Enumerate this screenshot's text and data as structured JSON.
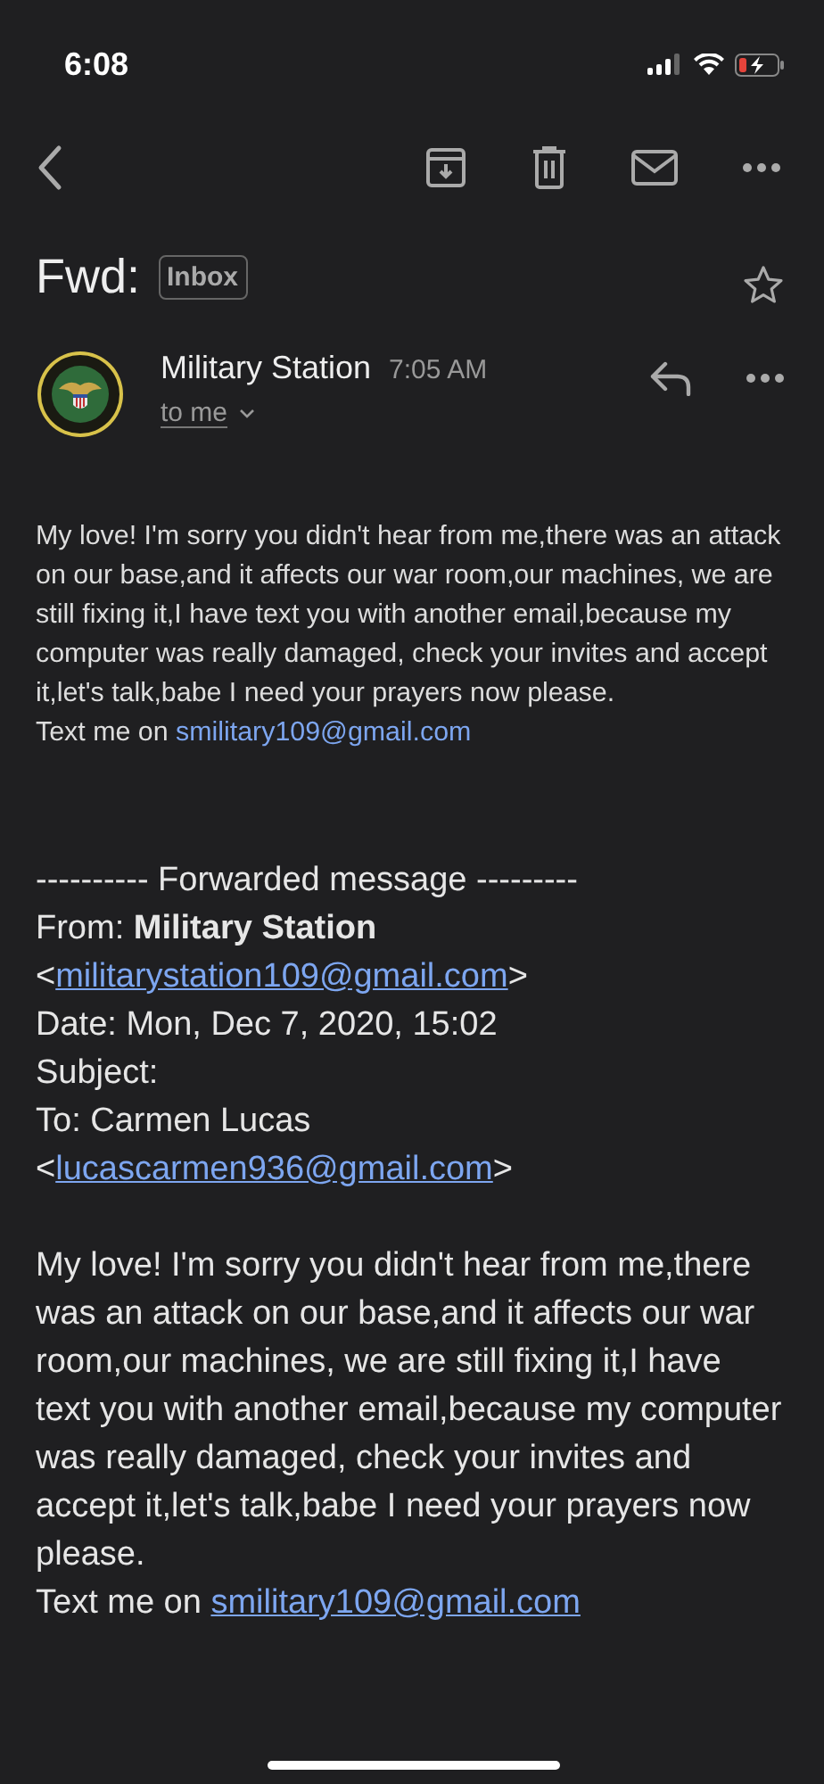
{
  "status_bar": {
    "time": "6:08",
    "battery_low": true
  },
  "subject": {
    "title": "Fwd:",
    "label": "Inbox",
    "starred": false
  },
  "sender": {
    "name": "Military Station",
    "time": "7:05 AM",
    "recipient": "to me"
  },
  "body": {
    "paragraph": "My love! I'm sorry you didn't hear from me,there was an attack on our base,and it affects our war room,our machines, we are still fixing it,I have text you with another email,because my computer was really damaged, check your invites and accept it,let's talk,babe I need your prayers now please.",
    "contact_prefix": "Text me on ",
    "contact_email": "smilitary109@gmail.com"
  },
  "forwarded": {
    "header": "---------- Forwarded message ---------",
    "from_line": "From: **Military Station**",
    "from_email": {
      "before": "<",
      "link": "militarystation109@gmail.com",
      "after": ">"
    },
    "date_line": "Date: Mon, Dec 7, 2020, 15:02",
    "subject_line": "Subject:",
    "to_line": "To: Carmen Lucas",
    "to_email": {
      "before": "<",
      "link": "lucascarmen936@gmail.com",
      "after": ">"
    },
    "paragraph": "My love! I'm sorry you didn't hear from me,there was an attack on our base,and it affects our war room,our machines, we are still fixing it,I have text you with another email,because my computer was really damaged, check your invites and accept it,let's talk,babe I need your prayers now please.",
    "contact_prefix": "Text me on ",
    "contact_email": "smilitary109@gmail.com"
  }
}
